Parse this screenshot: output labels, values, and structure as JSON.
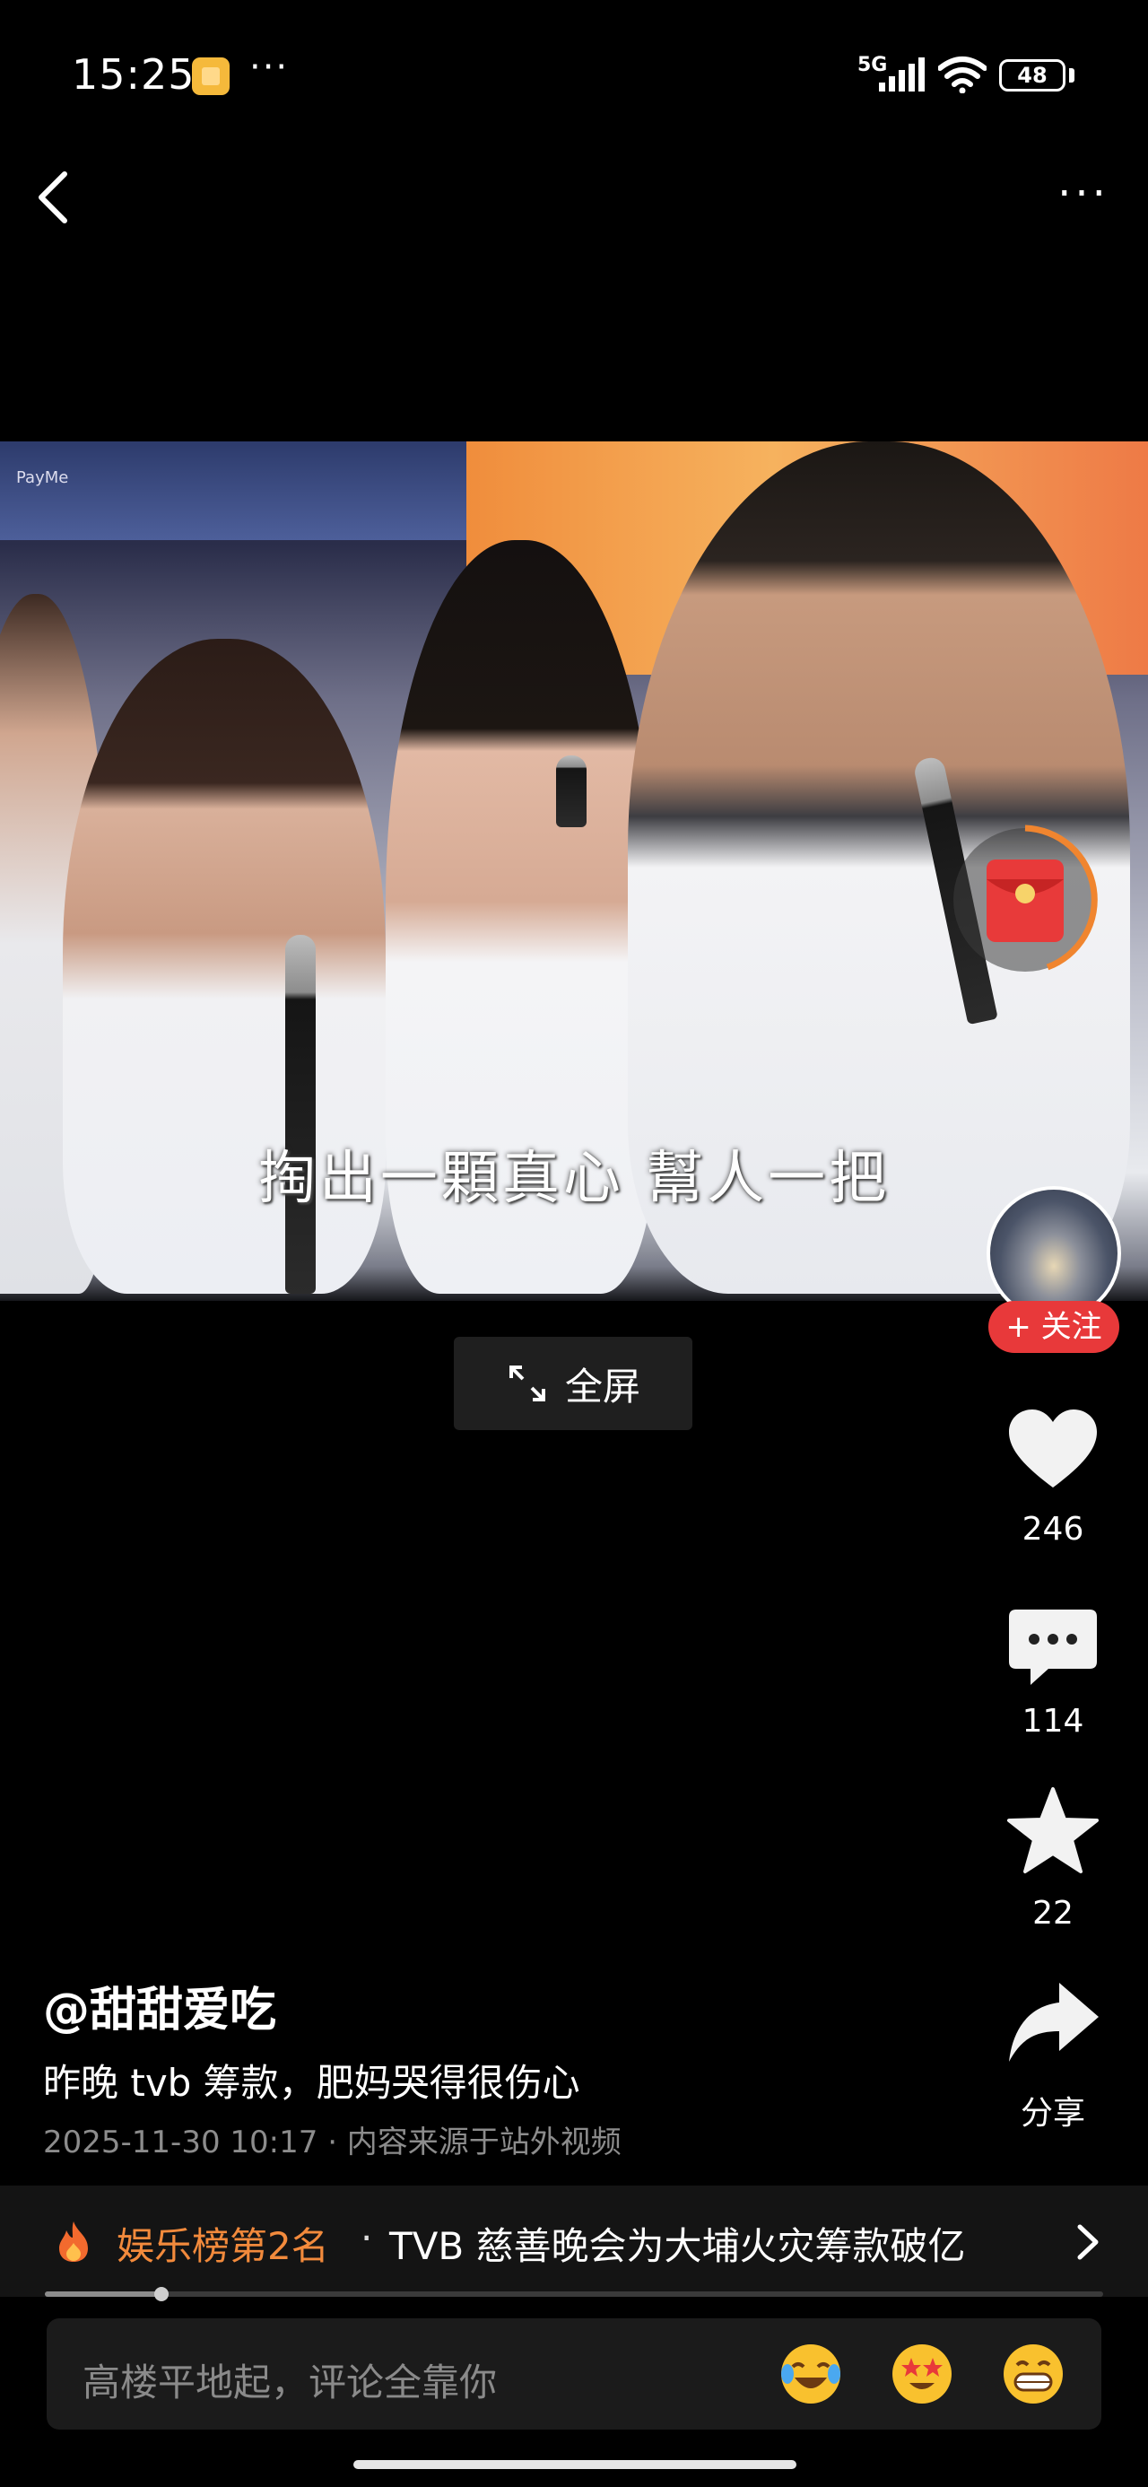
{
  "status_bar": {
    "time": "15:25",
    "more": "···",
    "network": "5G",
    "battery": "48"
  },
  "nav": {
    "back_icon": "chevron-left-icon",
    "more_icon": "more-dots-icon",
    "more": "···"
  },
  "video": {
    "subtitle": "掏出一顆真心  幫人一把",
    "corner_text": "PayMe",
    "fullscreen_label": "全屏"
  },
  "rail": {
    "follow_label": "+ 关注",
    "likes": "246",
    "comments": "114",
    "favorites": "22",
    "share_label": "分享"
  },
  "post": {
    "author": "@甜甜爱吃",
    "description": "昨晚 tvb 筹款，肥妈哭得很伤心",
    "meta": "2025-11-30 10:17 · 内容来源于站外视频"
  },
  "trending": {
    "rank": "娱乐榜第2名",
    "separator": "·",
    "title": "TVB 慈善晚会为大埔火灾筹款破亿"
  },
  "playback": {
    "progress_fraction": 0.11
  },
  "comment_input": {
    "placeholder": "高楼平地起，评论全靠你",
    "emojis": [
      "laughing-crying-emoji",
      "star-eyes-emoji",
      "grinning-emoji"
    ]
  },
  "colors": {
    "accent_red": "#e8393a",
    "trend_orange": "#f28a3c",
    "background": "#000000"
  }
}
